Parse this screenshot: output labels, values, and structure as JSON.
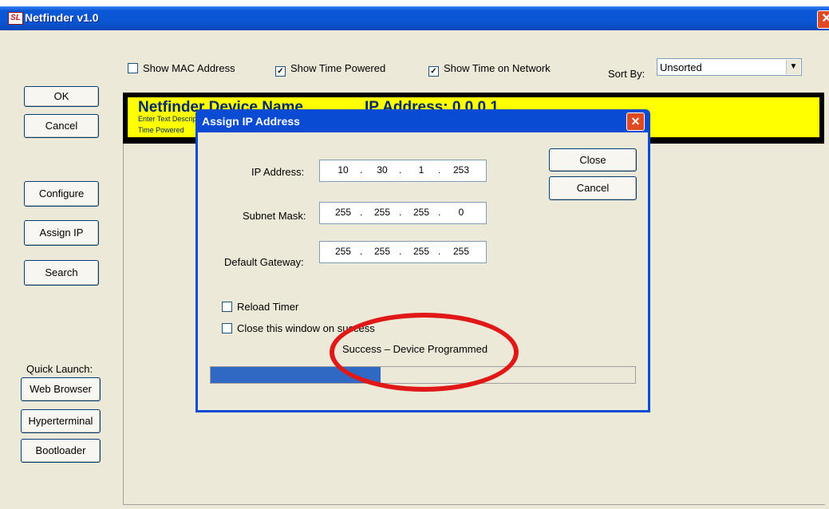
{
  "window": {
    "title": "Netfinder v1.0",
    "close_glyph": "✕",
    "icon": "netfinder-app-icon",
    "icon_glyph": "SL"
  },
  "options": {
    "show_mac": {
      "label": "Show MAC Address",
      "checked": false
    },
    "show_time_powered": {
      "label": "Show Time Powered",
      "checked": true
    },
    "show_time_network": {
      "label": "Show Time on Network",
      "checked": true
    },
    "sort_label": "Sort By:",
    "sort_value": "Unsorted"
  },
  "sidebar": {
    "ok": "OK",
    "cancel": "Cancel",
    "configure": "Configure",
    "assign_ip": "Assign IP",
    "search": "Search",
    "quick_launch_label": "Quick Launch:",
    "web_browser": "Web Browser",
    "hyperterminal": "Hyperterminal",
    "bootloader": "Bootloader"
  },
  "device": {
    "name": "Netfinder Device Name",
    "ip": "IP Address: 0.0.0.1",
    "desc": "Enter Text Description",
    "time_powered": "Time Powered"
  },
  "dialog": {
    "title": "Assign IP Address",
    "close_glyph": "✕",
    "ip_label": "IP Address:",
    "ip": [
      "10",
      "30",
      "1",
      "253"
    ],
    "mask_label": "Subnet Mask:",
    "mask": [
      "255",
      "255",
      "255",
      "0"
    ],
    "gateway_label": "Default Gateway:",
    "gateway": [
      "255",
      "255",
      "255",
      "255"
    ],
    "dot": ".",
    "close_button": "Close",
    "cancel_button": "Cancel",
    "reload_timer": {
      "label": "Reload Timer",
      "checked": false
    },
    "close_on_success": {
      "label": "Close this window on success",
      "checked": false
    },
    "status": "Success – Device Programmed",
    "progress": 0.4
  },
  "colors": {
    "highlight_circle": "#e01818",
    "device_panel": "#ffff00",
    "progress": "#3069c4"
  }
}
